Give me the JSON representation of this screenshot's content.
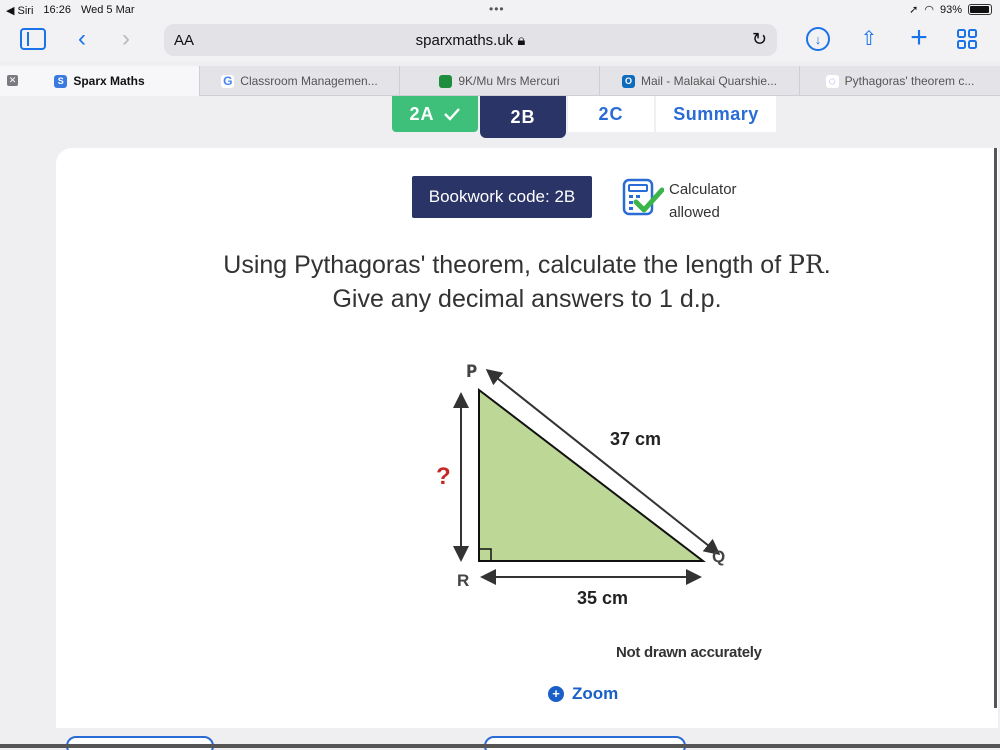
{
  "status_bar": {
    "back_app": "◀ Siri",
    "time": "16:26",
    "date": "Wed 5 Mar",
    "battery": "93%"
  },
  "toolbar": {
    "text_size": "AA",
    "url": "sparxmaths.uk"
  },
  "tabs": [
    {
      "label": "Sparx Maths",
      "icon": "S",
      "color": "#3b7be0"
    },
    {
      "label": "Classroom Managemen...",
      "icon": "G",
      "color": "#4285f4"
    },
    {
      "label": "9K/Mu Mrs Mercuri",
      "icon": "C",
      "color": "#1e8e3e"
    },
    {
      "label": "Mail - Malakai Quarshie...",
      "icon": "O",
      "color": "#0f6cbd"
    },
    {
      "label": "Pythagoras' theorem c...",
      "icon": "◌",
      "color": "#6b8cff"
    }
  ],
  "question_tabs": {
    "a": "2A",
    "b": "2B",
    "c": "2C",
    "summary": "Summary"
  },
  "bookwork": "Bookwork code: 2B",
  "calculator": {
    "line1": "Calculator",
    "line2": "allowed"
  },
  "question": {
    "line1_pre": "Using Pythagoras' theorem, calculate the length of ",
    "line1_var": "PR",
    "line1_post": ".",
    "line2": "Give any decimal answers to 1 d.p."
  },
  "diagram": {
    "P": "P",
    "Q": "Q",
    "R": "R",
    "hypotenuse": "37 cm",
    "base": "35 cm",
    "unknown": "?",
    "fill": "#bcd796"
  },
  "note": "Not drawn accurately",
  "zoom": "Zoom"
}
